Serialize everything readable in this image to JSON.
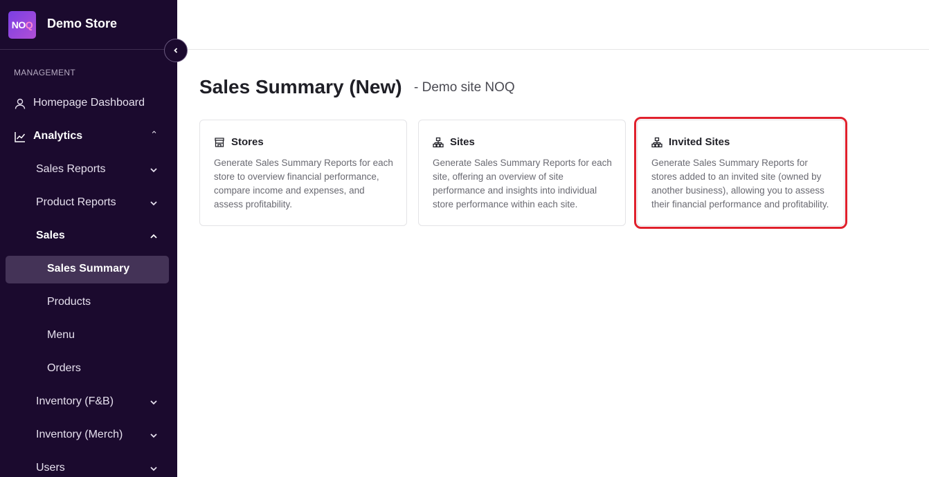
{
  "brand": {
    "logo_text": "NO",
    "logo_q": "Q",
    "store_name": "Demo Store"
  },
  "sidebar": {
    "section_label": "MANAGEMENT",
    "items": [
      {
        "label": "Homepage Dashboard",
        "icon": "user-icon"
      },
      {
        "label": "Analytics",
        "icon": "chart-line-icon",
        "expanded": true
      },
      {
        "label": "Sales Reports",
        "expanded": false
      },
      {
        "label": "Product Reports",
        "expanded": false
      },
      {
        "label": "Sales",
        "expanded": true
      },
      {
        "label": "Sales Summary",
        "active": true
      },
      {
        "label": "Products"
      },
      {
        "label": "Menu"
      },
      {
        "label": "Orders"
      },
      {
        "label": "Inventory (F&B)",
        "expanded": false
      },
      {
        "label": "Inventory (Merch)",
        "expanded": false
      },
      {
        "label": "Users",
        "expanded": false
      }
    ]
  },
  "main": {
    "title": "Sales Summary (New)",
    "subtitle": "- Demo site NOQ",
    "cards": [
      {
        "title": "Stores",
        "icon": "store-icon",
        "description": "Generate Sales Summary Reports for each store to overview financial performance, compare income and expenses, and assess profitability."
      },
      {
        "title": "Sites",
        "icon": "sitemap-icon",
        "description": "Generate Sales Summary Reports for each site, offering an overview of site performance and insights into individual store performance within each site."
      },
      {
        "title": "Invited Sites",
        "icon": "sitemap-icon",
        "description": "Generate Sales Summary Reports for stores added to an invited site (owned by another business), allowing you to assess their financial performance and profitability."
      }
    ]
  },
  "colors": {
    "sidebar_bg": "#1b0a2e",
    "active_item_bg": "#443357",
    "highlight": "#e0202c"
  }
}
